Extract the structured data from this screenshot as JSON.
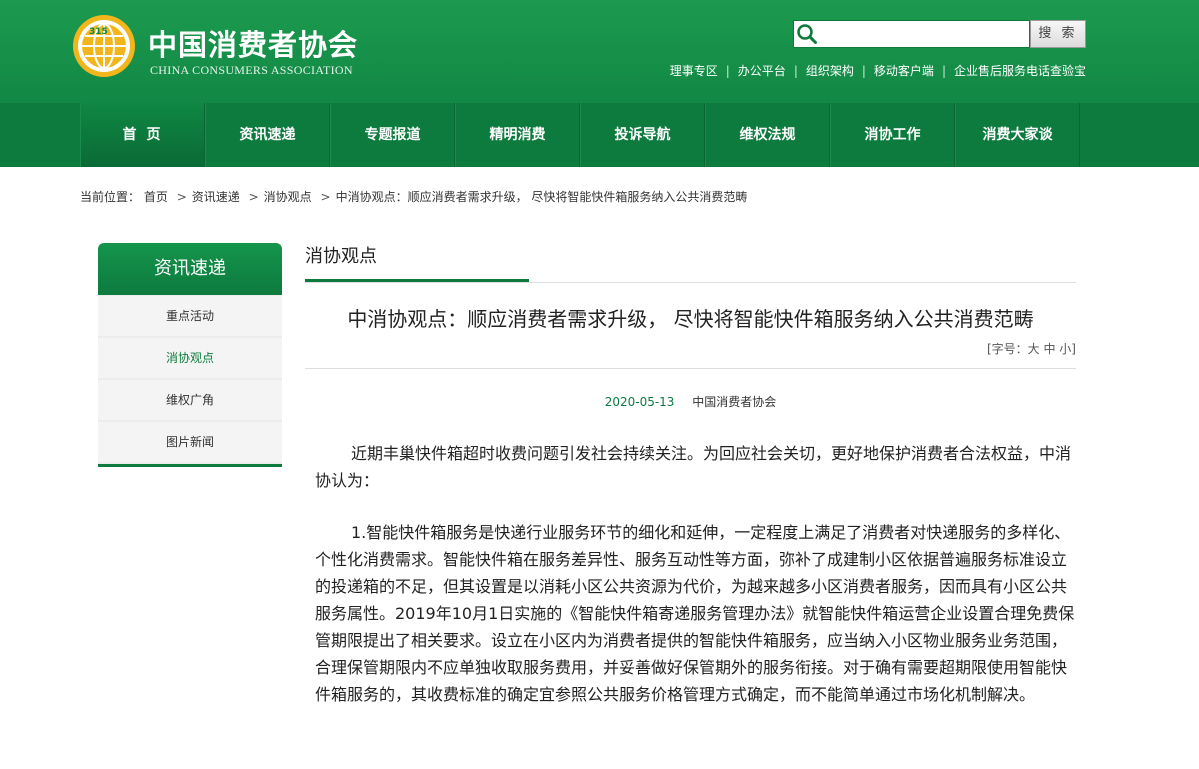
{
  "header": {
    "logo_cn": "中国消费者协会",
    "logo_en": "CHINA CONSUMERS ASSOCIATION",
    "search_button": "搜 索",
    "search_placeholder": "",
    "toplinks": [
      "理事专区",
      "办公平台",
      "组织架构",
      "移动客户端",
      "企业售后服务电话查验宝"
    ]
  },
  "nav": {
    "items": [
      "首页",
      "资讯速递",
      "专题报道",
      "精明消费",
      "投诉导航",
      "维权法规",
      "消协工作",
      "消费大家谈"
    ]
  },
  "breadcrumb": {
    "label": "当前位置：",
    "items": [
      "首页",
      "资讯速递",
      "消协观点",
      "中消协观点：顺应消费者需求升级， 尽快将智能快件箱服务纳入公共消费范畴"
    ]
  },
  "sidebar": {
    "title": "资讯速递",
    "items": [
      "重点活动",
      "消协观点",
      "维权广角",
      "图片新闻"
    ],
    "active": 1
  },
  "main": {
    "column_title": "消协观点",
    "article_title": "中消协观点：顺应消费者需求升级， 尽快将智能快件箱服务纳入公共消费范畴",
    "font_size_label": "[字号：大 中 小]",
    "date": "2020-05-13",
    "source": "中国消费者协会",
    "paragraphs": [
      "近期丰巢快件箱超时收费问题引发社会持续关注。为回应社会关切，更好地保护消费者合法权益，中消协认为：",
      "1.智能快件箱服务是快递行业服务环节的细化和延伸，一定程度上满足了消费者对快递服务的多样化、个性化消费需求。智能快件箱在服务差异性、服务互动性等方面，弥补了成建制小区依据普遍服务标准设立的投递箱的不足，但其设置是以消耗小区公共资源为代价，为越来越多小区消费者服务，因而具有小区公共服务属性。2019年10月1日实施的《智能快件箱寄递服务管理办法》就智能快件箱运营企业设置合理免费保管期限提出了相关要求。设立在小区内为消费者提供的智能快件箱服务，应当纳入小区物业服务业务范围，合理保管期限内不应单独收取服务费用，并妥善做好保管期外的服务衔接。对于确有需要超期限使用智能快件箱服务的，其收费标准的确定宜参照公共服务价格管理方式确定，而不能简单通过市场化机制解决。"
    ]
  },
  "colors": {
    "brand_green": "#0d7a3e",
    "header_green": "#1d9a4f",
    "logo_gold": "#f2b51b"
  }
}
